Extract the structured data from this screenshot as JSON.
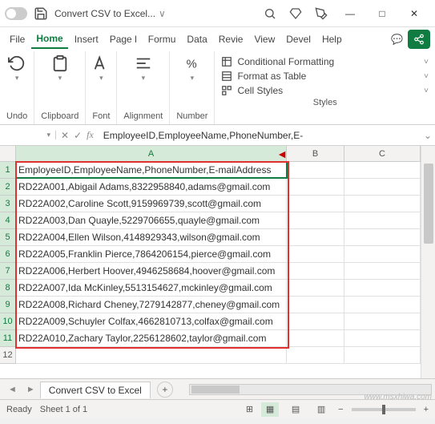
{
  "titlebar": {
    "filename": "Convert CSV to Excel..."
  },
  "menu": {
    "file": "File",
    "home": "Home",
    "insert": "Insert",
    "page": "Page l",
    "formu": "Formu",
    "data": "Data",
    "review": "Revie",
    "view": "View",
    "devel": "Devel",
    "help": "Help"
  },
  "ribbon": {
    "undo": "Undo",
    "clipboard": "Clipboard",
    "font": "Font",
    "alignment": "Alignment",
    "number": "Number",
    "cond_format": "Conditional Formatting",
    "format_table": "Format as Table",
    "cell_styles": "Cell Styles",
    "styles": "Styles"
  },
  "formula_bar": {
    "namebox": "",
    "formula": "EmployeeID,EmployeeName,PhoneNumber,E-"
  },
  "columns": [
    "A",
    "B",
    "C"
  ],
  "rows": [
    {
      "n": "1",
      "a": "EmployeeID,EmployeeName,PhoneNumber,E-mailAddress"
    },
    {
      "n": "2",
      "a": "RD22A001,Abigail Adams,8322958840,adams@gmail.com"
    },
    {
      "n": "3",
      "a": "RD22A002,Caroline Scott,9159969739,scott@gmail.com"
    },
    {
      "n": "4",
      "a": "RD22A003,Dan Quayle,5229706655,quayle@gmail.com"
    },
    {
      "n": "5",
      "a": "RD22A004,Ellen Wilson,4148929343,wilson@gmail.com"
    },
    {
      "n": "6",
      "a": "RD22A005,Franklin Pierce,7864206154,pierce@gmail.com"
    },
    {
      "n": "7",
      "a": "RD22A006,Herbert Hoover,4946258684,hoover@gmail.com"
    },
    {
      "n": "8",
      "a": "RD22A007,Ida McKinley,5513154627,mckinley@gmail.com"
    },
    {
      "n": "9",
      "a": "RD22A008,Richard Cheney,7279142877,cheney@gmail.com"
    },
    {
      "n": "10",
      "a": "RD22A009,Schuyler Colfax,4662810713,colfax@gmail.com"
    },
    {
      "n": "11",
      "a": "RD22A010,Zachary Taylor,2256128602,taylor@gmail.com"
    },
    {
      "n": "12",
      "a": ""
    }
  ],
  "sheet": {
    "name": "Convert CSV to Excel"
  },
  "status": {
    "ready": "Ready",
    "sheet_info": "Sheet 1 of 1",
    "zoom": "+"
  },
  "watermark": "www.msxhiwa.com"
}
